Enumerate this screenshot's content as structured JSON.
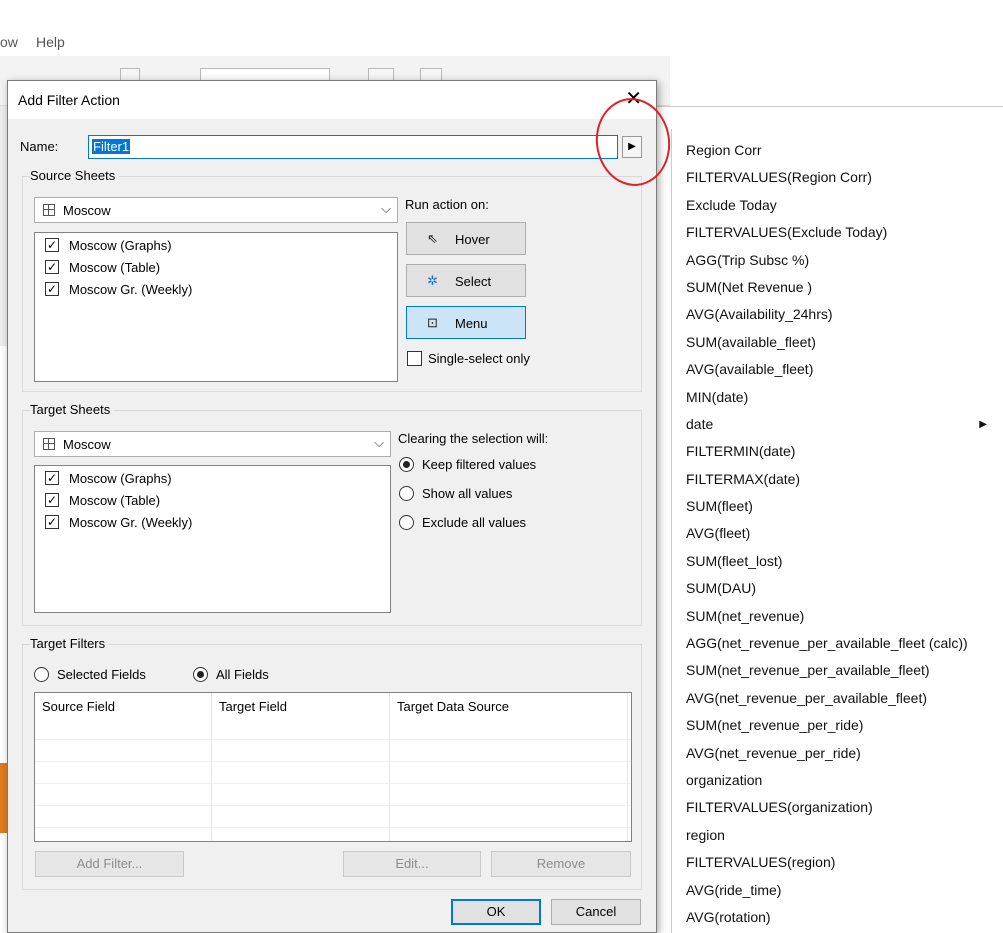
{
  "app": {
    "menu": [
      "ow",
      "Help"
    ]
  },
  "dialog": {
    "title": "Add Filter Action",
    "close_glyph": "✕",
    "name_label": "Name:",
    "name_value": "Filter1",
    "name_arrow": "▶",
    "source": {
      "label": "Source Sheets",
      "combo_value": "Moscow",
      "sheets": [
        "Moscow (Graphs)",
        "Moscow (Table)",
        "Moscow Gr. (Weekly)"
      ],
      "run_label": "Run action on:",
      "buttons": {
        "hover": "Hover",
        "select": "Select",
        "menu": "Menu"
      },
      "single_select": "Single-select only"
    },
    "target": {
      "label": "Target Sheets",
      "combo_value": "Moscow",
      "sheets": [
        "Moscow (Graphs)",
        "Moscow (Table)",
        "Moscow Gr. (Weekly)"
      ],
      "clearing_label": "Clearing the selection will:",
      "options": [
        "Keep filtered values",
        "Show all values",
        "Exclude all values"
      ]
    },
    "filters": {
      "label": "Target Filters",
      "selected_fields": "Selected Fields",
      "all_fields": "All Fields",
      "columns": [
        "Source Field",
        "Target Field",
        "Target Data Source"
      ],
      "add_filter": "Add Filter...",
      "edit": "Edit...",
      "remove": "Remove"
    },
    "ok": "OK",
    "cancel": "Cancel"
  },
  "field_menu": {
    "items": [
      "Region Corr",
      "FILTERVALUES(Region Corr)",
      "Exclude Today",
      "FILTERVALUES(Exclude Today)",
      "AGG(Trip Subsc %)",
      "SUM(Net Revenue )",
      "AVG(Availability_24hrs)",
      "SUM(available_fleet)",
      "AVG(available_fleet)",
      "MIN(date)",
      "date",
      "FILTERMIN(date)",
      "FILTERMAX(date)",
      "SUM(fleet)",
      "AVG(fleet)",
      "SUM(fleet_lost)",
      "SUM(DAU)",
      "SUM(net_revenue)",
      "AGG(net_revenue_per_available_fleet (calc))",
      "SUM(net_revenue_per_available_fleet)",
      "AVG(net_revenue_per_available_fleet)",
      "SUM(net_revenue_per_ride)",
      "AVG(net_revenue_per_ride)",
      "organization",
      "FILTERVALUES(organization)",
      "region",
      "FILTERVALUES(region)",
      "AVG(ride_time)",
      "AVG(rotation)"
    ],
    "submenu_glyph": "▶"
  }
}
